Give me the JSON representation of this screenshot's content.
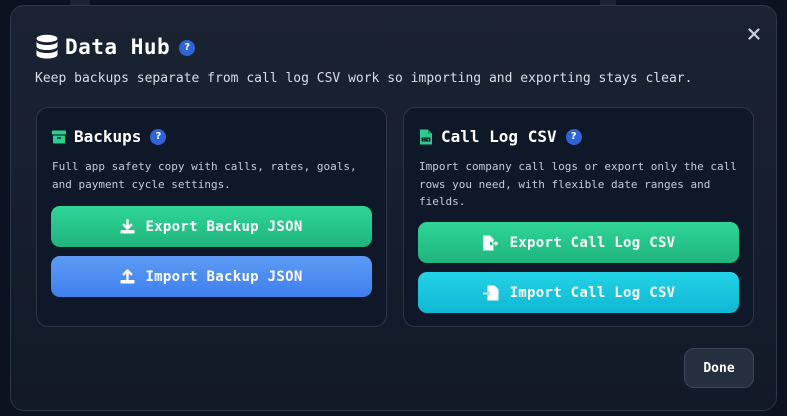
{
  "dialog": {
    "title": "Data Hub",
    "help_glyph": "?",
    "close_glyph": "×",
    "subtitle": "Keep backups separate from call log CSV work so importing and exporting stays clear.",
    "done_label": "Done"
  },
  "backups": {
    "icon": "archive-box-icon",
    "title": "Backups",
    "description": "Full app safety copy with calls, rates, goals, and payment cycle settings.",
    "export_label": "Export Backup JSON",
    "import_label": "Import Backup JSON"
  },
  "call_log": {
    "icon": "csv-file-icon",
    "title": "Call Log CSV",
    "description": "Import company call logs or export only the call rows you need, with flexible date ranges and fields.",
    "export_label": "Export Call Log CSV",
    "import_label": "Import Call Log CSV"
  },
  "colors": {
    "accent_help": "#2f63d8",
    "green": "#22c285",
    "blue": "#4a8af0",
    "cyan": "#18c3dc",
    "background": "#0b1220",
    "card": "#0f1828"
  }
}
